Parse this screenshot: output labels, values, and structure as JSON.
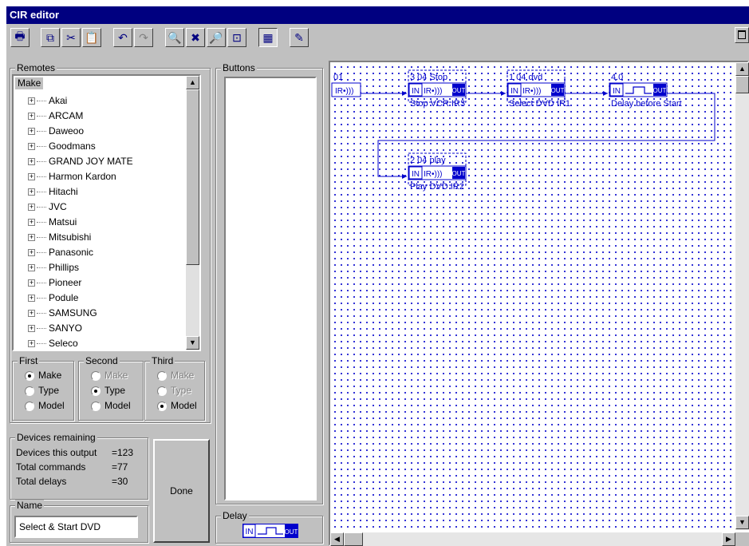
{
  "window": {
    "title": "CIR editor"
  },
  "toolbar": {
    "buttons": [
      {
        "name": "print-icon",
        "glyph": "🖶"
      },
      {
        "name": "copy-icon",
        "glyph": "⧉"
      },
      {
        "name": "cut-icon",
        "glyph": "✂"
      },
      {
        "name": "paste-icon",
        "glyph": "📋"
      },
      {
        "name": "undo-icon",
        "glyph": "↶"
      },
      {
        "name": "redo-icon",
        "glyph": "↷"
      },
      {
        "name": "zoom-out-icon",
        "glyph": "🔍"
      },
      {
        "name": "delete-icon",
        "glyph": "✖"
      },
      {
        "name": "zoom-in-icon",
        "glyph": "🔎"
      },
      {
        "name": "fit-icon",
        "glyph": "⊡"
      },
      {
        "name": "grid-icon",
        "glyph": "▦"
      },
      {
        "name": "pencil-icon",
        "glyph": "✎"
      }
    ]
  },
  "remotes": {
    "title": "Remotes",
    "header": "Make",
    "items": [
      "Akai",
      "ARCAM",
      "Daweoo",
      "Goodmans",
      "GRAND JOY MATE",
      "Harmon Kardon",
      "Hitachi",
      "JVC",
      "Matsui",
      "Mitsubishi",
      "Panasonic",
      "Phillips",
      "Pioneer",
      "Podule",
      "SAMSUNG",
      "SANYO",
      "Seleco"
    ],
    "sort_groups": [
      {
        "title": "First",
        "options": [
          {
            "label": "Make",
            "checked": true,
            "disabled": false
          },
          {
            "label": "Type",
            "checked": false,
            "disabled": false
          },
          {
            "label": "Model",
            "checked": false,
            "disabled": false
          }
        ]
      },
      {
        "title": "Second",
        "options": [
          {
            "label": "Make",
            "checked": false,
            "disabled": true
          },
          {
            "label": "Type",
            "checked": true,
            "disabled": false
          },
          {
            "label": "Model",
            "checked": false,
            "disabled": false
          }
        ]
      },
      {
        "title": "Third",
        "options": [
          {
            "label": "Make",
            "checked": false,
            "disabled": true
          },
          {
            "label": "Type",
            "checked": false,
            "disabled": true
          },
          {
            "label": "Model",
            "checked": true,
            "disabled": false
          }
        ]
      }
    ]
  },
  "stats": {
    "title": "Devices remaining",
    "rows": [
      {
        "label": "Devices this output",
        "value": "=123"
      },
      {
        "label": "Total commands",
        "value": "=77"
      },
      {
        "label": "Total delays",
        "value": "=30"
      }
    ]
  },
  "name_box": {
    "title": "Name",
    "value": "Select & Start DVD"
  },
  "done_button": {
    "label": "Done"
  },
  "buttons_panel": {
    "title": "Buttons"
  },
  "delay_panel": {
    "title": "Delay",
    "in": "IN",
    "out": "OUT"
  },
  "flow": {
    "nodes": [
      {
        "id": "n0",
        "top": "01",
        "bottom": "",
        "kind": "source",
        "label": "IR•)))"
      },
      {
        "id": "n1",
        "top": "3 04 Stop",
        "bottom": "Stop VCR IR3",
        "kind": "ir"
      },
      {
        "id": "n2",
        "top": "1 04 dvd",
        "bottom": "Select DVD IR1",
        "kind": "ir"
      },
      {
        "id": "n3",
        "top": "4.0",
        "bottom": "Delay before Start",
        "kind": "delay"
      },
      {
        "id": "n4",
        "top": "2 04 play",
        "bottom": "Play DVD IR2",
        "kind": "ir"
      }
    ],
    "in": "IN",
    "out": "OUT",
    "ir": "IR•)))"
  }
}
